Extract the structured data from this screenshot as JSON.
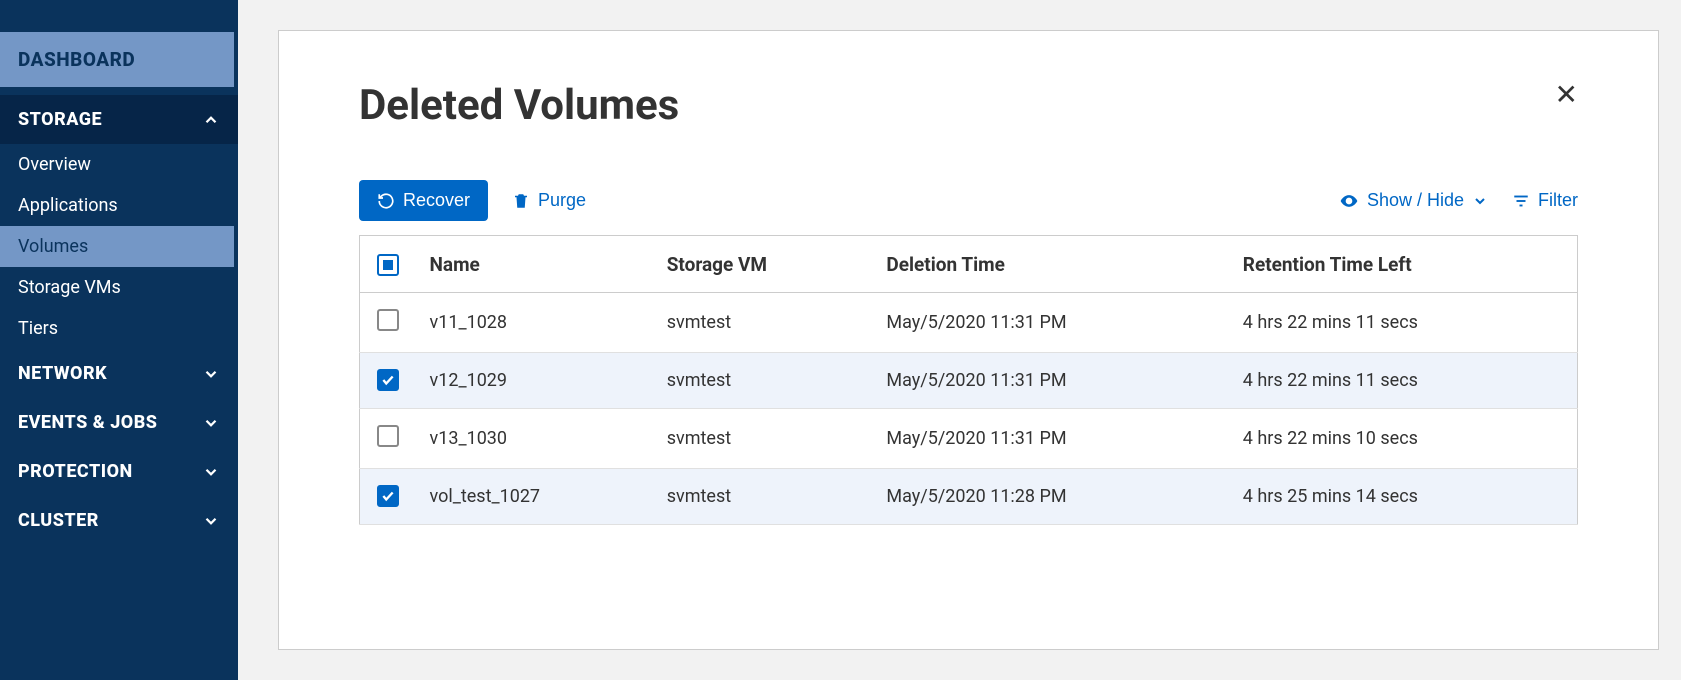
{
  "sidebar": {
    "dashboard": "DASHBOARD",
    "storage": {
      "label": "STORAGE",
      "items": [
        "Overview",
        "Applications",
        "Volumes",
        "Storage VMs",
        "Tiers"
      ]
    },
    "network": "NETWORK",
    "events": "EVENTS & JOBS",
    "protection": "PROTECTION",
    "cluster": "CLUSTER"
  },
  "page": {
    "title": "Deleted Volumes"
  },
  "toolbar": {
    "recover": "Recover",
    "purge": "Purge",
    "showhide": "Show / Hide",
    "filter": "Filter"
  },
  "table": {
    "headers": {
      "name": "Name",
      "svm": "Storage VM",
      "deltime": "Deletion Time",
      "retention": "Retention Time Left"
    },
    "rows": [
      {
        "selected": false,
        "name": "v11_1028",
        "svm": "svmtest",
        "deltime": "May/5/2020 11:31 PM",
        "retention": "4 hrs 22 mins 11 secs"
      },
      {
        "selected": true,
        "name": "v12_1029",
        "svm": "svmtest",
        "deltime": "May/5/2020 11:31 PM",
        "retention": "4 hrs 22 mins 11 secs"
      },
      {
        "selected": false,
        "name": "v13_1030",
        "svm": "svmtest",
        "deltime": "May/5/2020 11:31 PM",
        "retention": "4 hrs 22 mins 10 secs"
      },
      {
        "selected": true,
        "name": "vol_test_1027",
        "svm": "svmtest",
        "deltime": "May/5/2020 11:28 PM",
        "retention": "4 hrs 25 mins 14 secs"
      }
    ]
  }
}
